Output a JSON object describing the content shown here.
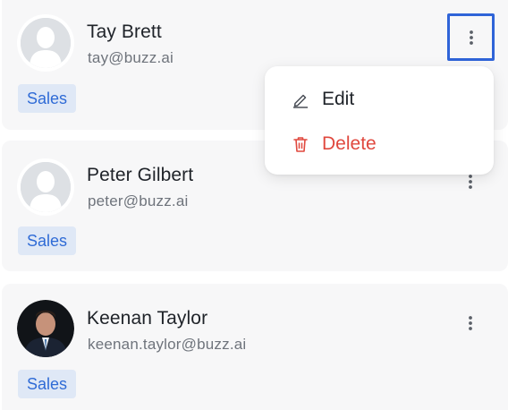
{
  "contacts": [
    {
      "name": "Tay Brett",
      "email": "tay@buzz.ai",
      "tag": "Sales",
      "avatar": "placeholder-person-icon"
    },
    {
      "name": "Peter Gilbert",
      "email": "peter@buzz.ai",
      "tag": "Sales",
      "avatar": "placeholder-person-icon"
    },
    {
      "name": "Keenan Taylor",
      "email": "keenan.taylor@buzz.ai",
      "tag": "Sales",
      "avatar": "photo"
    }
  ],
  "menu": {
    "edit_label": "Edit",
    "delete_label": "Delete",
    "edit_icon": "pencil-icon",
    "delete_icon": "trash-icon"
  },
  "colors": {
    "card_bg": "#f7f7f8",
    "tag_bg": "#dfe8f6",
    "tag_text": "#2f6bd6",
    "delete_red": "#e0483e",
    "focus_ring": "#2f64d8"
  }
}
